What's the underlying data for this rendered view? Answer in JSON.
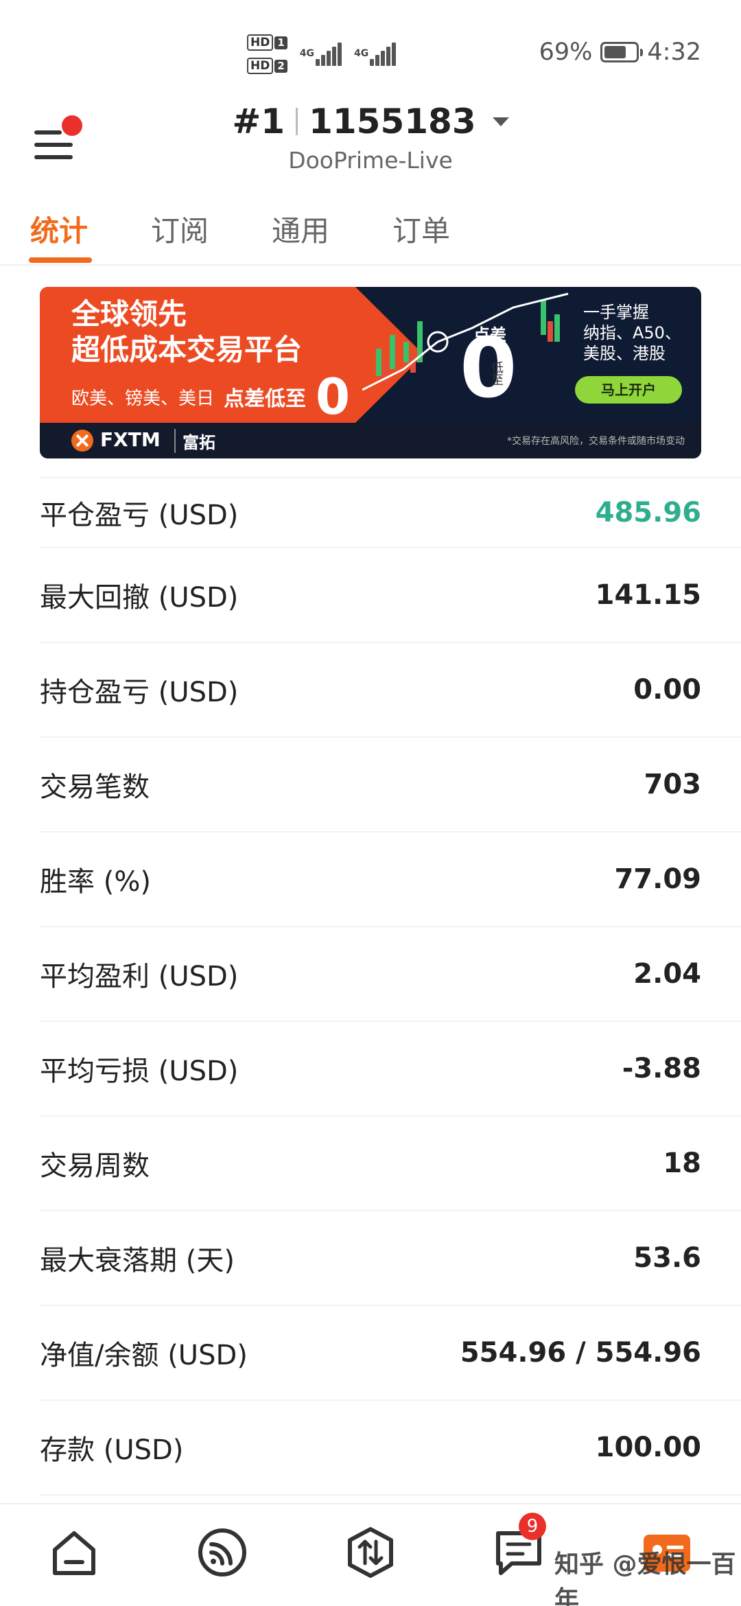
{
  "status_bar": {
    "hd1": "HD",
    "hd1_num": "1",
    "hd2": "HD",
    "hd2_num": "2",
    "net1": "4G",
    "net2": "4G",
    "battery": "69%",
    "battery_level": 0.69,
    "time": "4:32"
  },
  "header": {
    "account_number": "#1",
    "account_id": "1155183",
    "server": "DooPrime-Live"
  },
  "tabs": [
    {
      "label": "统计"
    },
    {
      "label": "订阅"
    },
    {
      "label": "通用"
    },
    {
      "label": "订单"
    }
  ],
  "banner": {
    "headline1": "全球领先",
    "headline2": "超低成本交易平台",
    "sub": "欧美、镑美、美日",
    "sub_bold": "点差低至",
    "sub_zero": "0",
    "spread_label": "点差",
    "big_zero": "0",
    "low_label": "低至",
    "right_line1": "一手掌握",
    "right_line2": "纳指、A50、",
    "right_line3": "美股、港股",
    "cta": "马上开户",
    "brand": "FXTM",
    "brand_cn": "富拓",
    "disclaimer": "*交易存在高风险，交易条件或随市场变动"
  },
  "stats": [
    {
      "label": "平仓盈亏 (USD)",
      "value": "485.96"
    },
    {
      "label": "最大回撤 (USD)",
      "value": "141.15"
    },
    {
      "label": "持仓盈亏 (USD)",
      "value": "0.00"
    },
    {
      "label": "交易笔数",
      "value": "703"
    },
    {
      "label": "胜率 (%)",
      "value": "77.09"
    },
    {
      "label": "平均盈利 (USD)",
      "value": "2.04"
    },
    {
      "label": "平均亏损 (USD)",
      "value": "-3.88"
    },
    {
      "label": "交易周数",
      "value": "18"
    },
    {
      "label": "最大衰落期 (天)",
      "value": "53.6"
    },
    {
      "label": "净值/余额 (USD)",
      "value": "554.96 / 554.96"
    },
    {
      "label": "存款 (USD)",
      "value": "100.00"
    }
  ],
  "colors": {
    "accent": "#f26b1d",
    "profit": "#2fae8e",
    "badge": "#e9302b"
  },
  "bottom_nav": {
    "messages_badge": "9",
    "watermark": "知乎 @爱恨一百年"
  }
}
